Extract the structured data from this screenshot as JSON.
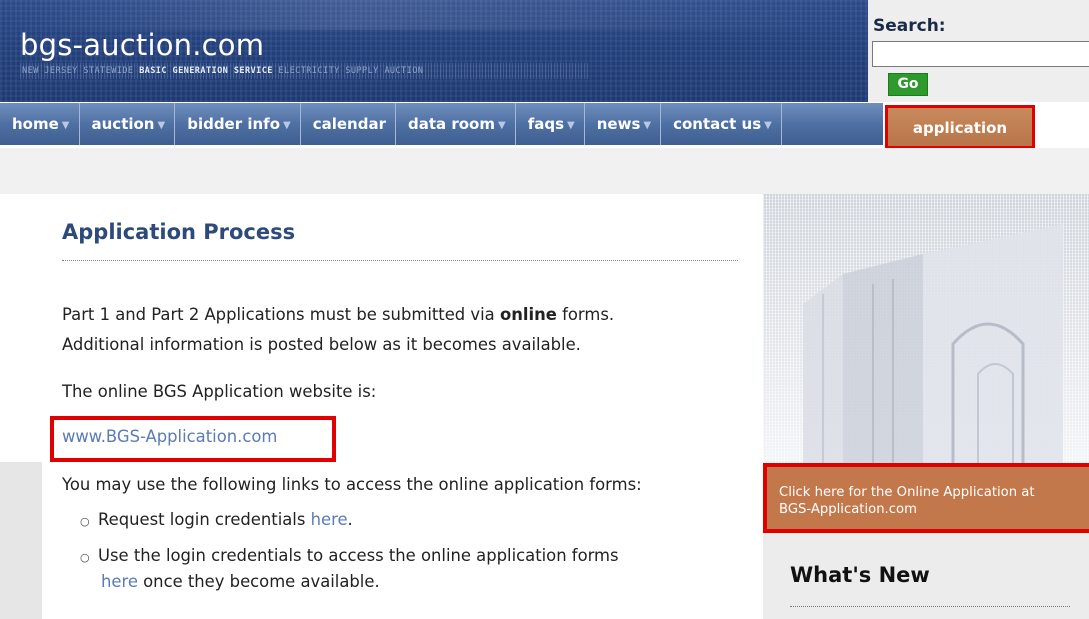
{
  "header": {
    "site_title": "bgs-auction.com",
    "tagline_part1": "NEW JERSEY STATEWIDE ",
    "tagline_part2": "BASIC GENERATION SERVICE",
    "tagline_part3": " ELECTRICITY SUPPLY AUCTION"
  },
  "search": {
    "label": "Search:",
    "value": "",
    "go_label": "Go"
  },
  "nav": {
    "items": [
      {
        "label": "home",
        "has_dropdown": true
      },
      {
        "label": "auction",
        "has_dropdown": true
      },
      {
        "label": "bidder info",
        "has_dropdown": true
      },
      {
        "label": "calendar",
        "has_dropdown": false
      },
      {
        "label": "data room",
        "has_dropdown": true
      },
      {
        "label": "faqs",
        "has_dropdown": true
      },
      {
        "label": "news",
        "has_dropdown": true
      },
      {
        "label": "contact us",
        "has_dropdown": true
      }
    ],
    "active_label": "application",
    "caret": "▼"
  },
  "main": {
    "title": "Application Process",
    "para1_a": "Part 1 and Part 2 Applications must be submitted via ",
    "para1_bold": "online",
    "para1_b": " forms.",
    "para1_line2": "Additional information is posted below as it becomes available.",
    "para2": "The online BGS Application website is:",
    "url_link": "www.BGS-Application.com",
    "para3": "You may use the following links to access the online application forms:",
    "bullet_glyph": "○",
    "bullet1_text": "Request login credentials ",
    "bullet1_link": "here",
    "bullet1_end": ".",
    "bullet2_line1": "Use the login credentials to access the online application forms",
    "bullet2_link": "here",
    "bullet2_end": " once they become available."
  },
  "sidebar": {
    "cta_line1": "Click here for the Online Application at",
    "cta_line2": "BGS-Application.com",
    "whats_new_title": "What's New"
  },
  "colors": {
    "header_blue": "#23407c",
    "nav_blue": "#4f70a3",
    "accent_orange": "#c3784c",
    "title_blue": "#2c4a7a",
    "link_blue": "#5a7bb5",
    "highlight_red": "#e00000",
    "go_green": "#2e9a2e"
  }
}
